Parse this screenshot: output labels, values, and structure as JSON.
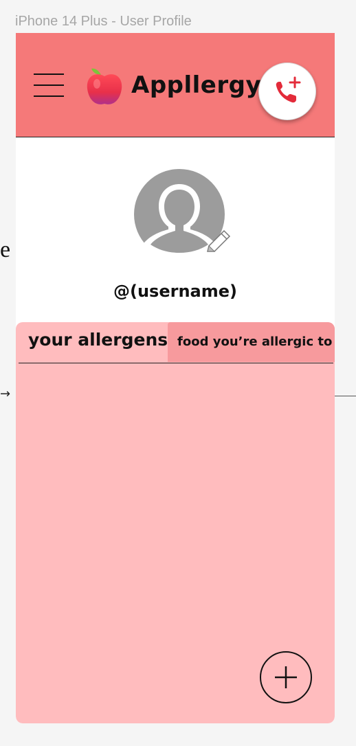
{
  "frame": {
    "label": "iPhone 14 Plus - User Profile"
  },
  "stray": {
    "char": "e",
    "arrow": "→"
  },
  "header": {
    "menu_icon": "hamburger-menu-icon",
    "logo_icon": "apple-icon",
    "app_name": "Appllergy",
    "call_icon": "phone-add-icon",
    "background_color": "#f57979"
  },
  "profile": {
    "avatar_icon": "user-silhouette-icon",
    "edit_icon": "pencil-icon",
    "username": "@(username)"
  },
  "tabs": {
    "active_label": "your allergens",
    "inactive_label": "food you’re allergic to"
  },
  "panel": {
    "background_color": "#ffbcbe",
    "add_icon": "plus-icon"
  }
}
